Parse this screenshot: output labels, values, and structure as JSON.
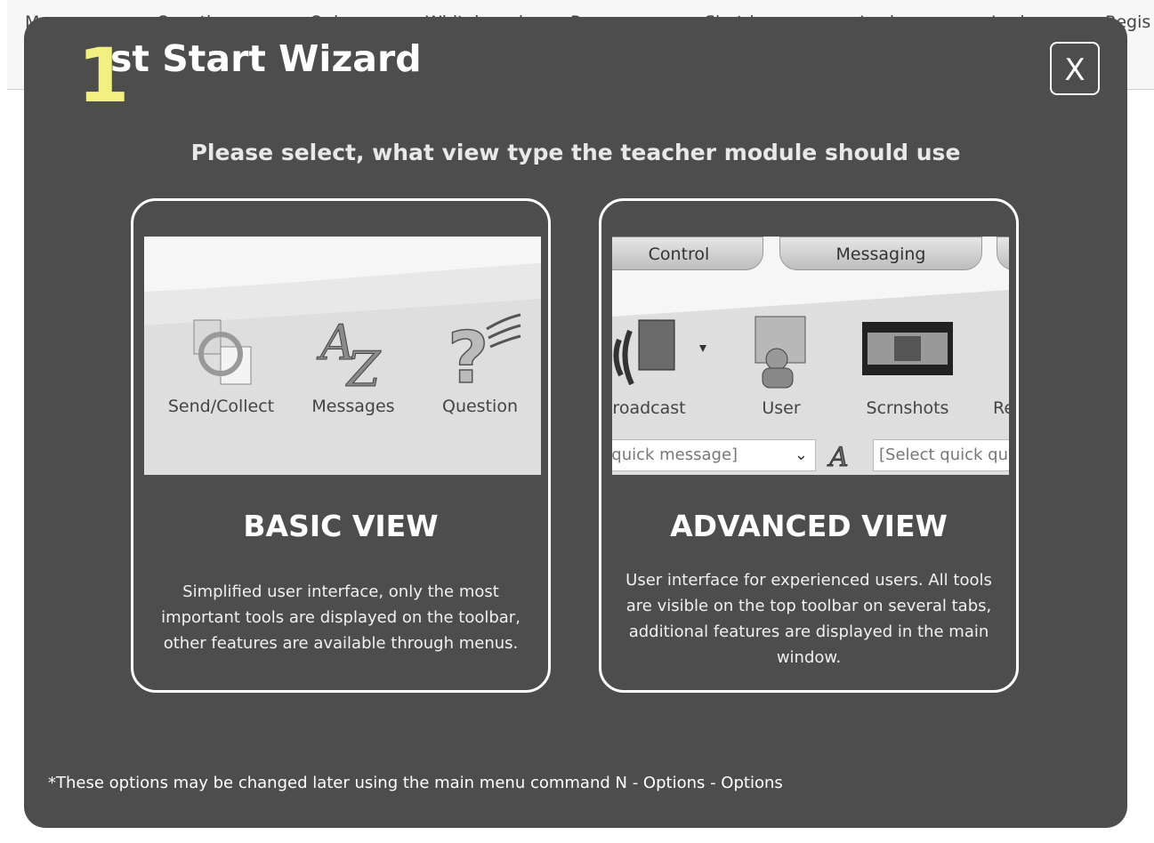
{
  "background_toolbar": {
    "items": [
      "Messages",
      "Question",
      "Quiz",
      "Whiteboard",
      "Programs",
      "Shutdown",
      "Login",
      "Lock",
      "Regis"
    ]
  },
  "wizard": {
    "title_number": "1",
    "title_rest": "st Start Wizard",
    "close_label": "X",
    "prompt": "Please select, what view type the teacher module should use",
    "footnote": "*These options may be changed later using the main menu command N - Options - Options"
  },
  "basic_view": {
    "heading": "BASIC VIEW",
    "description": "Simplified user interface, only the most important tools are displayed on the toolbar, other features are available through menus.",
    "preview_tools": [
      "Send/Collect",
      "Messages",
      "Question"
    ]
  },
  "advanced_view": {
    "heading": "ADVANCED VIEW",
    "description": "User interface for experienced users. All tools are visible on the top toolbar on several tabs, additional features are displayed in the main window.",
    "preview_tabs": [
      "Control",
      "Messaging"
    ],
    "preview_tools": [
      "Broadcast",
      "User",
      "Scrnshots",
      "Re"
    ],
    "quick_message_placeholder": "[Select quick message]",
    "quick_question_placeholder": "[Select quick question]"
  },
  "colors": {
    "modal_bg": "#4d4d4d",
    "title_number": "#f3f082",
    "text": "#ffffff"
  }
}
